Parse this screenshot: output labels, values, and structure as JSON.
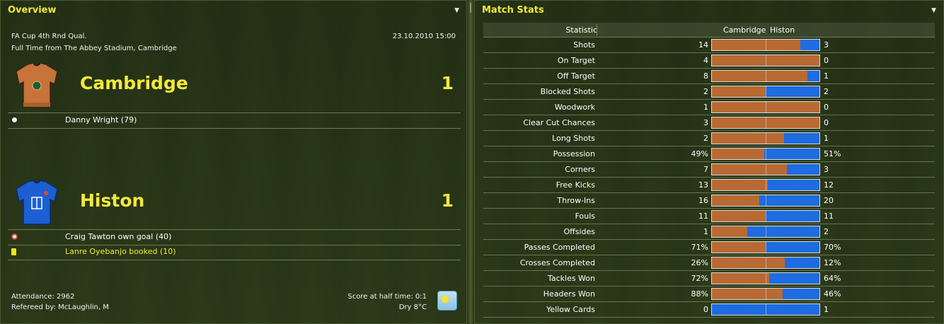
{
  "overview": {
    "title": "Overview",
    "competition": "FA Cup 4th Rnd Qual.",
    "datetime": "23.10.2010 15:00",
    "venue_line": "Full Time from The Abbey Stadium, Cambridge",
    "home": {
      "name": "Cambridge",
      "score": "1",
      "kit_color": "#c8733a",
      "events": [
        {
          "type": "goal",
          "text": "Danny Wright (79)"
        }
      ]
    },
    "away": {
      "name": "Histon",
      "score": "1",
      "kit_color": "#1c5fd3",
      "events": [
        {
          "type": "own-goal",
          "text": "Craig Tawton own goal (40)"
        },
        {
          "type": "yellow-card",
          "text": "Lanre Oyebanjo booked (10)"
        }
      ]
    },
    "attendance": "Attendance: 2962",
    "referee": "Refereed by: McLaughlin, M",
    "half_time": "Score at half time: 0:1",
    "weather": "Dry 8°C"
  },
  "match_stats": {
    "title": "Match Stats",
    "headers": {
      "statistic": "Statistic",
      "home": "Cambridge",
      "away": "Histon"
    },
    "colors": {
      "home": "#b86a32",
      "away": "#1f6be0"
    },
    "rows": [
      {
        "label": "Shots",
        "home": "14",
        "away": "3",
        "home_share": 0.82
      },
      {
        "label": "On Target",
        "home": "4",
        "away": "0",
        "home_share": 1.0
      },
      {
        "label": "Off Target",
        "home": "8",
        "away": "1",
        "home_share": 0.89
      },
      {
        "label": "Blocked Shots",
        "home": "2",
        "away": "2",
        "home_share": 0.5
      },
      {
        "label": "Woodwork",
        "home": "1",
        "away": "0",
        "home_share": 1.0
      },
      {
        "label": "Clear Cut Chances",
        "home": "3",
        "away": "0",
        "home_share": 1.0
      },
      {
        "label": "Long Shots",
        "home": "2",
        "away": "1",
        "home_share": 0.67
      },
      {
        "label": "Possession",
        "home": "49%",
        "away": "51%",
        "home_share": 0.49
      },
      {
        "label": "Corners",
        "home": "7",
        "away": "3",
        "home_share": 0.7
      },
      {
        "label": "Free Kicks",
        "home": "13",
        "away": "12",
        "home_share": 0.52
      },
      {
        "label": "Throw-Ins",
        "home": "16",
        "away": "20",
        "home_share": 0.44
      },
      {
        "label": "Fouls",
        "home": "11",
        "away": "11",
        "home_share": 0.5
      },
      {
        "label": "Offsides",
        "home": "1",
        "away": "2",
        "home_share": 0.33
      },
      {
        "label": "Passes Completed",
        "home": "71%",
        "away": "70%",
        "home_share": 0.5
      },
      {
        "label": "Crosses Completed",
        "home": "26%",
        "away": "12%",
        "home_share": 0.68
      },
      {
        "label": "Tackles Won",
        "home": "72%",
        "away": "64%",
        "home_share": 0.53
      },
      {
        "label": "Headers Won",
        "home": "88%",
        "away": "46%",
        "home_share": 0.66
      },
      {
        "label": "Yellow Cards",
        "home": "0",
        "away": "1",
        "home_share": 0.0
      }
    ]
  }
}
